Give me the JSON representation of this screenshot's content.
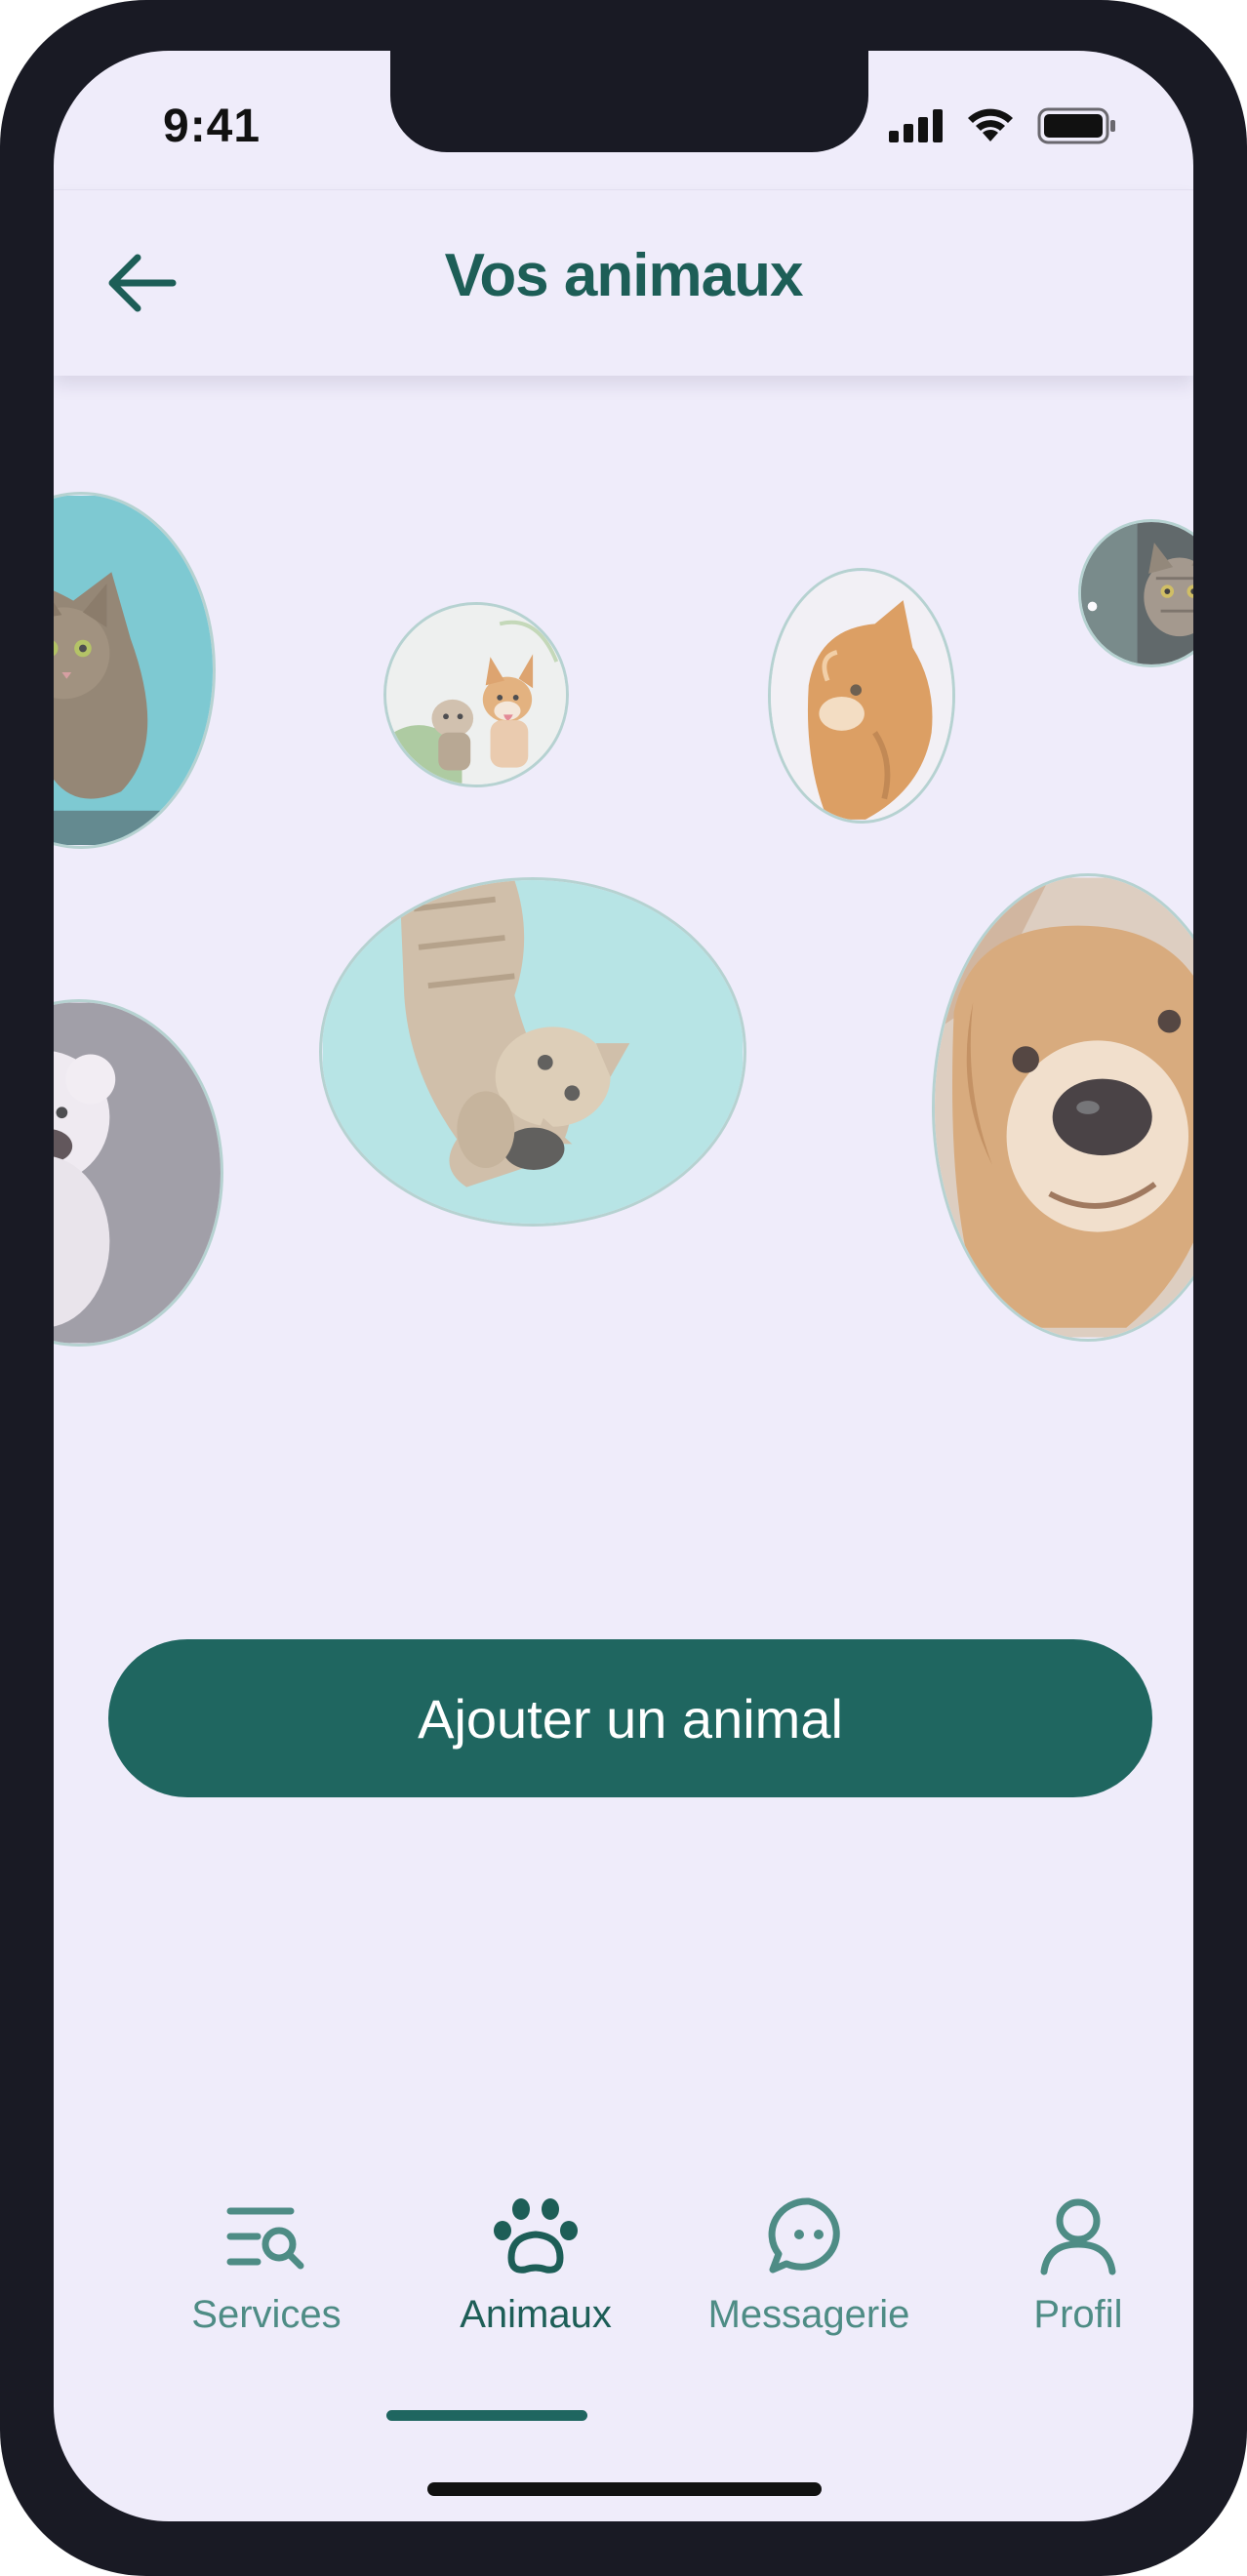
{
  "status_bar": {
    "time": "9:41"
  },
  "header": {
    "title": "Vos animaux"
  },
  "pets": [
    {
      "name": "cat-on-blue"
    },
    {
      "name": "two-dogs"
    },
    {
      "name": "ginger-cat"
    },
    {
      "name": "tabby-cat"
    },
    {
      "name": "white-dog"
    },
    {
      "name": "playing-kitten"
    },
    {
      "name": "golden-dog"
    }
  ],
  "actions": {
    "add_pet": "Ajouter un animal"
  },
  "tabbar": {
    "services": "Services",
    "animals": "Animaux",
    "messages": "Messagerie",
    "profile": "Profil"
  },
  "colors": {
    "accent": "#1f6660",
    "background": "#efecfa",
    "tab_inactive": "#4e8c85"
  }
}
